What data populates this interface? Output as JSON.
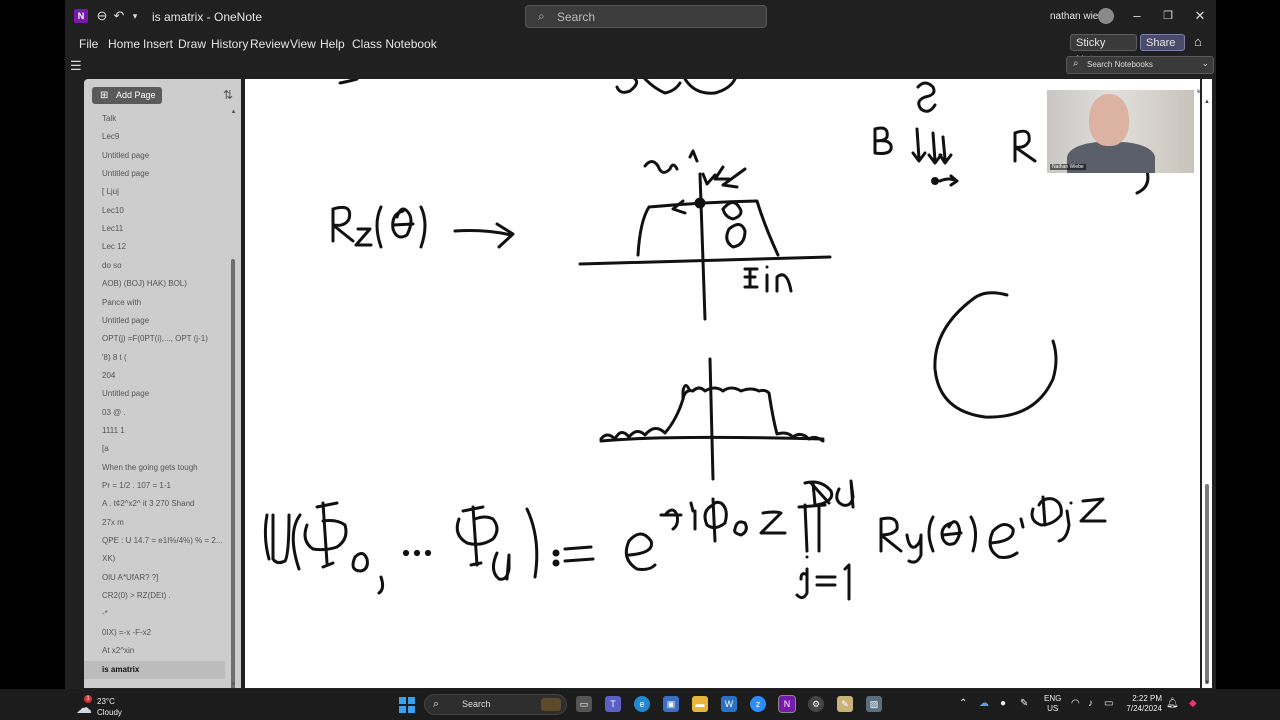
{
  "window": {
    "title": "is amatrix  -  OneNote",
    "search_placeholder": "Search",
    "user_name": "nathan wiebe"
  },
  "menu": [
    "File",
    "Home",
    "Insert",
    "Draw",
    "History",
    "Review",
    "View",
    "Help",
    "Class Notebook"
  ],
  "toolbar": {
    "sticky_notes": "Sticky Notes",
    "share": "Share",
    "search_notebooks": "Search Notebooks"
  },
  "pages_panel": {
    "add_page_label": "Add Page",
    "pages": [
      "Talk",
      "Lec9",
      "Untitled page",
      "Untitled page",
      "[ Ljuj",
      "Lec10",
      "Lec11",
      "Lec 12",
      "do so",
      "AOB) (BOJ) HAK) BOL)",
      "Pance with",
      "Untitled page",
      "OPT(j) =F(0PT(i),..., OPT (j-1)",
      "'8) 8 t (",
      "204",
      "Untitled page",
      "03 @ .",
      "1111 1",
      "[a",
      "When the going gets tough",
      "Pr = 1/2 . 107 = 1-1",
      "A . t¢2^x2^ it 3 270 Shand",
      "27x m",
      "QPE : U 14.7 = e1I%/4%) % = 2...",
      "XK)",
      "OlU A*UfAR? ?]",
      "CR2(0) > RZ(DEt) .",
      "-*",
      "0IX) =-x -F-x2",
      "At x2^xin",
      "is amatrix"
    ],
    "selected_index": 30
  },
  "canvas": {
    "webcam_name": "Nathan Wiebe"
  },
  "taskbar": {
    "weather_badge": "1",
    "temperature": "23°C",
    "condition": "Cloudy",
    "search_label": "Search",
    "language": "ENG",
    "region": "US",
    "time": "2:22 PM",
    "date": "7/24/2024"
  }
}
